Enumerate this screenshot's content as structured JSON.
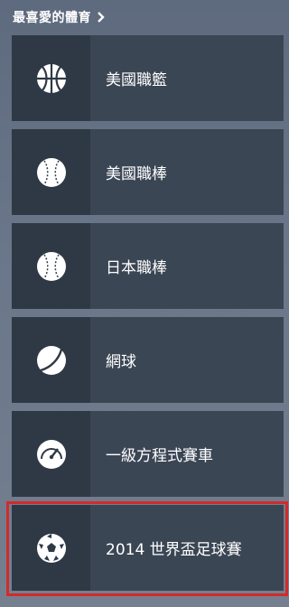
{
  "header": {
    "title": "最喜愛的體育",
    "chevron": "›"
  },
  "sports": [
    {
      "label": "美國職籃",
      "icon": "basketball-icon"
    },
    {
      "label": "美國職棒",
      "icon": "baseball-icon"
    },
    {
      "label": "日本職棒",
      "icon": "baseball-icon"
    },
    {
      "label": "網球",
      "icon": "tennis-ball-icon"
    },
    {
      "label": "一級方程式賽車",
      "icon": "speedometer-icon"
    },
    {
      "label": "2014 世界盃足球賽",
      "icon": "soccer-ball-icon",
      "selected": true
    }
  ],
  "colors": {
    "tile": "#3b4654",
    "icon_box": "#2f3946",
    "highlight": "#d32a2a"
  }
}
